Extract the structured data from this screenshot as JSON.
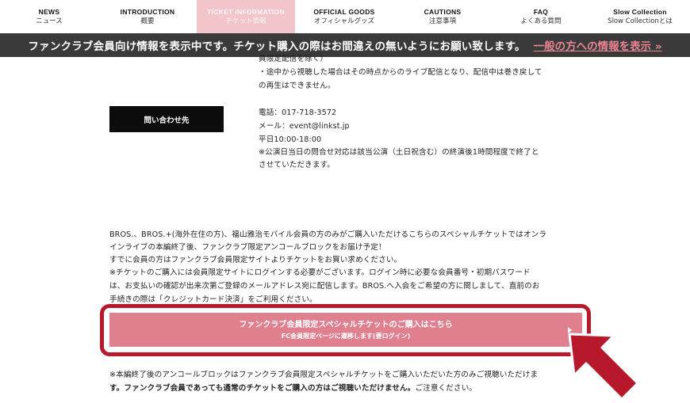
{
  "nav": [
    {
      "en": "NEWS",
      "ja": "ニュース",
      "active": false
    },
    {
      "en": "INTRODUCTION",
      "ja": "概要",
      "active": false
    },
    {
      "en": "TICKET INFORMATION",
      "ja": "チケット情報",
      "active": true
    },
    {
      "en": "OFFICIAL GOODS",
      "ja": "オフィシャルグッズ",
      "active": false
    },
    {
      "en": "CAUTIONS",
      "ja": "注意事項",
      "active": false
    },
    {
      "en": "FAQ",
      "ja": "よくある質問",
      "active": false
    },
    {
      "en": "Slow Collection",
      "ja": "Slow Collectionとは",
      "active": false
    }
  ],
  "infobar": {
    "message": "ファンクラブ会員向け情報を表示中です。チケット購入の際はお間違えの無いようにお願い致します。",
    "link": "一般の方への情報を表示 »"
  },
  "top_notes": {
    "line0": "員限定配信を除く）",
    "line1": "・途中から視聴した場合はその時点からのライブ配信となり、配信中は巻き戻して",
    "line2": "の再生はできません。"
  },
  "contact": {
    "button": "問い合わせ先",
    "phone": "電話：017-718-3572",
    "email": "メール：event@linkst.jp",
    "hours": "平日10:00-18:00",
    "note1": "※公演日当日の問合せ対応は該当公演（土日祝含む）の終演後1時間程度で終了と",
    "note2": "させていただきます。"
  },
  "body_text": {
    "p1": "BROS.、BROS.+(海外在住の方)、福山雅治モバイル会員の方のみがご購入いただけるこちらのスペシャルチケットではオンラ",
    "p2": "インライブの本編終了後、ファンクラブ限定アンコールブロックをお届け予定！",
    "p3": "すでに会員の方はファンクラブ会員限定サイトよりチケットをお買い求めください。",
    "p4": "※チケットのご購入には会員限定サイトにログインする必要がございます。ログイン時に必要な会員番号・初期パスワード",
    "p5": "は、お支払いの確認が出来次第ご登録のメールアドレス宛に配信します。BROS.へ入会をご希望の方に関しまして、直前のお",
    "p6": "手続きの際は「クレジットカード決済」をご利用ください。"
  },
  "cta": {
    "line1": "ファンクラブ会員限定スペシャルチケットのご購入はこちら",
    "line2": "FC会員限定ページに遷移します(要ログイン)"
  },
  "footer_text": {
    "f1": "※本編終了後のアンコールブロックはファンクラブ会員限定スペシャルチケットをご購入いただいた方のみご視聴いただけま",
    "f2_bold": "す。ファンクラブ会員であっても通常のチケットをご購入の方はご視聴いただけません。",
    "f2_rest": "ご注意ください。"
  },
  "colors": {
    "accent_pink": "#e0808f",
    "highlight_red": "#b8182b",
    "infobar_bg": "#3a3a3a",
    "link_pink": "#e98493"
  },
  "icons": {
    "cta_chevron": "chevron-right-icon",
    "pointer": "arrow-pointer-icon"
  }
}
